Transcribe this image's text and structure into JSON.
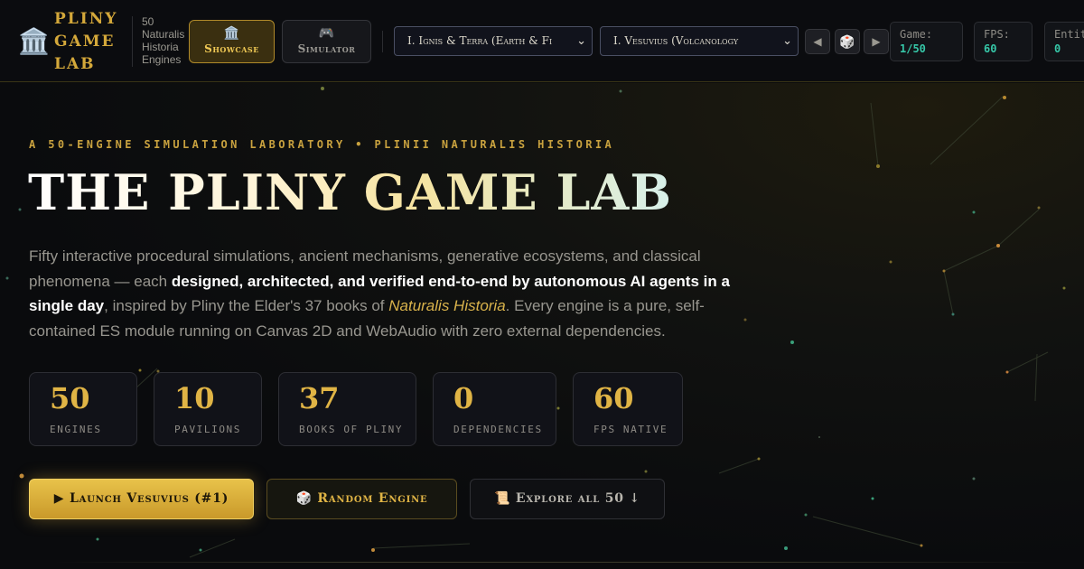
{
  "header": {
    "logo_icon": "🏛️",
    "brand_lines": [
      "PLINY",
      "GAME",
      "LAB"
    ],
    "subtitle_lines": [
      "50",
      "Naturalis",
      "Historia",
      "Engines"
    ],
    "modes": {
      "showcase": {
        "icon": "🏛️",
        "label": "Showcase",
        "active": true
      },
      "simulator": {
        "icon": "🎮",
        "label": "Simulator",
        "active": false
      }
    },
    "game_select": {
      "value": "I. Ignis & Terra (Earth & Fi"
    },
    "preset_select": {
      "value": "I. Vesuvius (Volcanology"
    },
    "chevron_icon": "⌄",
    "nav": {
      "prev": "◀",
      "random": "🎲",
      "next": "▶"
    },
    "stats": {
      "game": {
        "label": "Game:",
        "value": "1/50"
      },
      "fps": {
        "label": "FPS:",
        "value": "60"
      },
      "entities": {
        "label": "Entit",
        "value": "0"
      }
    }
  },
  "hero": {
    "kicker": "A 50-ENGINE SIMULATION LABORATORY • PLINII NATURALIS HISTORIA",
    "title": "THE PLINY GAME LAB",
    "lede": {
      "part1": "Fifty interactive procedural simulations, ancient mechanisms, generative ecosystems, and classical phenomena — each ",
      "bold": "designed, architected, and verified end-to-end by autonomous AI agents in a single day",
      "part2": ", inspired by Pliny the Elder's 37 books of ",
      "italic": "Naturalis Historia",
      "part3": ". Every engine is a pure, self-contained ES module running on Canvas 2D and WebAudio with zero external dependencies."
    },
    "metrics": [
      {
        "value": "50",
        "label": "ENGINES"
      },
      {
        "value": "10",
        "label": "PAVILIONS"
      },
      {
        "value": "37",
        "label": "BOOKS OF PLINY"
      },
      {
        "value": "0",
        "label": "DEPENDENCIES"
      },
      {
        "value": "60",
        "label": "FPS NATIVE"
      }
    ],
    "cta": {
      "launch": "▶ Launch Vesuvius (#1)",
      "random": "🎲 Random Engine",
      "explore": "📜 Explore all 50 ↓"
    }
  },
  "colors": {
    "accent_gold": "#e0b445",
    "accent_teal": "#36c7a8",
    "background": "#0a0b0d"
  }
}
